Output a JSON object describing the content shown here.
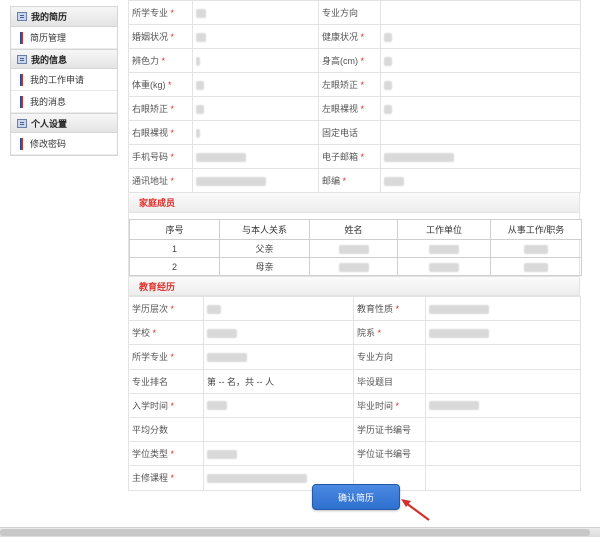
{
  "sidebar": {
    "sections": [
      {
        "title": "我的简历",
        "icon": "resume-icon",
        "items": [
          "简历管理"
        ]
      },
      {
        "title": "我的信息",
        "icon": "info-icon",
        "items": [
          "我的工作申请",
          "我的消息"
        ]
      },
      {
        "title": "个人设置",
        "icon": "settings-icon",
        "items": [
          "修改密码"
        ]
      }
    ]
  },
  "personal": {
    "rows": [
      {
        "l1": "所学专业",
        "r1": true,
        "l2": "专业方向",
        "r2": false
      },
      {
        "l1": "婚姻状况",
        "r1": true,
        "l2": "健康状况",
        "r2": true
      },
      {
        "l1": "辨色力",
        "r1": true,
        "l2": "身高(cm)",
        "r2": true
      },
      {
        "l1": "体重(kg)",
        "r1": true,
        "l2": "左眼矫正",
        "r2": true
      },
      {
        "l1": "右眼矫正",
        "r1": true,
        "l2": "左眼裸视",
        "r2": true
      },
      {
        "l1": "右眼裸视",
        "r1": true,
        "l2": "固定电话",
        "r2": false
      },
      {
        "l1": "手机号码",
        "r1": true,
        "l2": "电子邮箱",
        "r2": true
      },
      {
        "l1": "通讯地址",
        "r1": true,
        "l2": "邮编",
        "r2": true
      }
    ]
  },
  "family": {
    "title": "家庭成员",
    "headers": [
      "序号",
      "与本人关系",
      "姓名",
      "工作单位",
      "从事工作/职务"
    ],
    "rows": [
      {
        "no": "1",
        "relation": "父亲"
      },
      {
        "no": "2",
        "relation": "母亲"
      }
    ]
  },
  "education": {
    "title": "教育经历",
    "rows": [
      {
        "l1": "学历层次",
        "r1": true,
        "v1": "",
        "l2": "教育性质",
        "r2": true
      },
      {
        "l1": "学校",
        "r1": true,
        "v1": "",
        "l2": "院系",
        "r2": true
      },
      {
        "l1": "所学专业",
        "r1": true,
        "v1": "",
        "l2": "专业方向",
        "r2": false
      },
      {
        "l1": "专业排名",
        "r1": false,
        "v1": "第 -- 名，共 -- 人",
        "l2": "毕设题目",
        "r2": false
      },
      {
        "l1": "入学时间",
        "r1": true,
        "v1": "",
        "l2": "毕业时间",
        "r2": true
      },
      {
        "l1": "平均分数",
        "r1": false,
        "v1": "",
        "l2": "学历证书编号",
        "r2": false
      },
      {
        "l1": "学位类型",
        "r1": true,
        "v1": "",
        "l2": "学位证书编号",
        "r2": false
      },
      {
        "l1": "主修课程",
        "r1": true,
        "v1": "",
        "l2": "",
        "r2": false
      }
    ]
  },
  "actions": {
    "confirm_label": "确认简历"
  },
  "colors": {
    "required": "#e0302b",
    "button": "#2f6fcf",
    "arrow": "#d0312d"
  }
}
